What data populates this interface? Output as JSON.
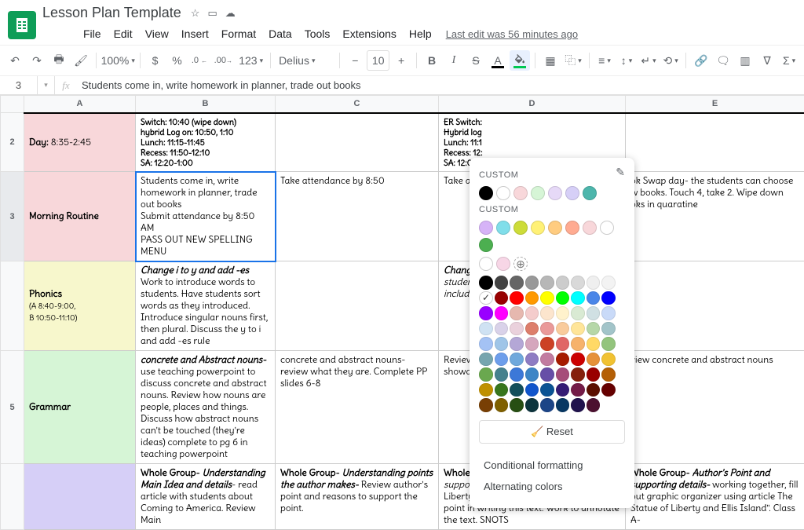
{
  "header": {
    "doc_title": "Lesson Plan Template",
    "last_edit": "Last edit was 56 minutes ago"
  },
  "menu": [
    "File",
    "Edit",
    "View",
    "Insert",
    "Format",
    "Data",
    "Tools",
    "Extensions",
    "Help"
  ],
  "toolbar": {
    "zoom": "100%",
    "currency": "$",
    "percent": "%",
    "decrease_dec": ".0",
    "increase_dec": ".00",
    "more_formats": "123",
    "font_name": "Delius",
    "font_size": "10"
  },
  "fx_row": {
    "namebox": "3",
    "formula": "Students come in, write homework in planner, trade out books"
  },
  "columns": [
    "A",
    "B",
    "C",
    "D",
    "E"
  ],
  "rows": {
    "2": {
      "a_label": "Day:",
      "a_value": " 8:35-2:45",
      "b": "Switch: 10:40 (wipe down)\nhybrid Log on: 10:50, 1:10\nLunch: 11:15-11:45\nRecess: 11:50-12:10\nSA: 12:20-1:00",
      "c": "",
      "d": "ER Switch:\nHybrid log\nLunch: 11:1\nRecess: 12:\nSA: 12:00-1",
      "e": ""
    },
    "3": {
      "a": "Morning Routine",
      "b": "Students come in, write homework in planner, trade out books\nSubmit attendance by 8:50 AM\nPASS OUT NEW SPELLING MENU",
      "c": "Take attendance by 8:50",
      "d": "Take att",
      "e": "ok Swap day- the students can choose w books. Touch 4, take 2. Wipe down oks in quaratine"
    },
    "4": {
      "a_title": "Phonics",
      "a_sub": "(A 8:40-9:00,\nB 10:50-11:10)",
      "b_em": "Change i to y and add -es",
      "b_rest": "Work to introduce words to students. Have students sort words as they introduced. Introduce singular nouns first, then plural. Discuss the y to i and add -es rule",
      "c": "",
      "d_em": "Change",
      "d_rest": "students\nincluding",
      "e": ""
    },
    "5": {
      "a": "Grammar",
      "b_em": "concrete and Abstract nouns-",
      "b_rest": " use teaching powerpoint to discuss concrete and abstract nouns. Review how nouns are people, places and things. Discuss how abstract nouns can't be touched (they're ideas) complete to pg 6 in teaching powerpoint",
      "c": "concrete and abstract nouns- review what they are. Complete PP slides 6-8",
      "d": "Review c\nshowdow",
      "e": "view concrete and abstract nouns"
    },
    "6": {
      "a": "",
      "b_em": "Whole Group- ",
      "b_em2": "Understanding Main Idea and details",
      "b_rest": "- read article with students about Coming to America. Review Main",
      "c_em": "Whole Group- ",
      "c_em2": "Understanding points the author makes-",
      "c_rest": " Review author's point and reasons to support the point.",
      "d_em": "Whole Group- ",
      "d_em2": "Author's point and supporting details-",
      "d_rest": " Read \"The Statue of Liberty and Ellis Island\". ID the author's point in writing this text. Work to annotate the text. SNOTS",
      "e_em": "Whole Group- ",
      "e_em2": "Author's Point and supporting details-",
      "e_rest": " working together, fill out graphic organizer using article The Statue of Liberty and Ellis Island\". Class A-"
    }
  },
  "popup": {
    "custom_title": "CUSTOM",
    "custom1": [
      "#000000",
      "#ffffff",
      "#f8d7da",
      "#d6f5d6",
      "#e6d9f7",
      "#d6cff7",
      "#4db6ac"
    ],
    "custom2": [
      "#d6b3f7",
      "#80deea",
      "#cddc39",
      "#fff176",
      "#ffcc80",
      "#ffab91",
      "#f8d7da",
      "#ffffff",
      "#4caf50"
    ],
    "custom3": [
      "#ffffff",
      "#f7d6e6"
    ],
    "reset": "Reset",
    "cond": "Conditional formatting",
    "alt": "Alternating colors",
    "palette": [
      [
        "#000000",
        "#434343",
        "#666666",
        "#999999",
        "#b7b7b7",
        "#cccccc",
        "#d9d9d9",
        "#efefef",
        "#f3f3f3",
        "#ffffff"
      ],
      [
        "#980000",
        "#ff0000",
        "#ff9900",
        "#ffff00",
        "#00ff00",
        "#00ffff",
        "#4a86e8",
        "#0000ff",
        "#9900ff",
        "#ff00ff"
      ],
      [
        "#e6b8af",
        "#f4cccc",
        "#fce5cd",
        "#fff2cc",
        "#d9ead3",
        "#d0e0e3",
        "#c9daf8",
        "#cfe2f3",
        "#d9d2e9",
        "#ead1dc"
      ],
      [
        "#dd7e6b",
        "#ea9999",
        "#f9cb9c",
        "#ffe599",
        "#b6d7a8",
        "#a2c4c9",
        "#a4c2f4",
        "#9fc5e8",
        "#b4a7d6",
        "#d5a6bd"
      ],
      [
        "#cc4125",
        "#e06666",
        "#f6b26b",
        "#ffd966",
        "#93c47d",
        "#76a5af",
        "#6d9eeb",
        "#6fa8dc",
        "#8e7cc3",
        "#c27ba0"
      ],
      [
        "#a61c00",
        "#cc0000",
        "#e69138",
        "#f1c232",
        "#6aa84f",
        "#45818e",
        "#3c78d8",
        "#3d85c6",
        "#674ea7",
        "#a64d79"
      ],
      [
        "#85200c",
        "#990000",
        "#b45f06",
        "#bf9000",
        "#38761d",
        "#134f5c",
        "#1155cc",
        "#0b5394",
        "#351c75",
        "#741b47"
      ],
      [
        "#5b0f00",
        "#660000",
        "#783f04",
        "#7f6000",
        "#274e13",
        "#0c343d",
        "#1c4587",
        "#073763",
        "#20124d",
        "#4c1130"
      ]
    ]
  },
  "chart_data": {
    "type": "table",
    "note": "spreadsheet content captured in rows"
  }
}
